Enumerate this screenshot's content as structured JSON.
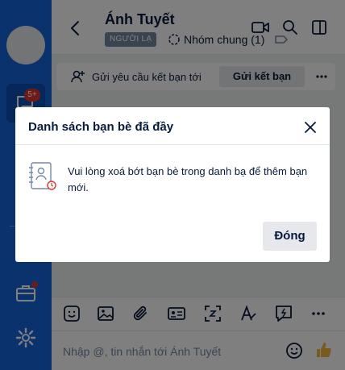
{
  "header": {
    "contact_name": "Ánh Tuyết",
    "stranger_tag": "NGƯỜI LẠ",
    "group_label": "Nhóm chung (1)"
  },
  "nav": {
    "unread_badge": "5+"
  },
  "friend_request_bar": {
    "text": "Gửi yêu cầu kết bạn tới",
    "button": "Gửi kết bạn"
  },
  "composer": {
    "placeholder": "Nhập @, tin nhắn tới Ánh Tuyết"
  },
  "modal": {
    "title": "Danh sách bạn bè đã đầy",
    "message": "Vui lòng xoá bớt bạn bè trong danh bạ để thêm bạn mới.",
    "close_button": "Đóng"
  },
  "colors": {
    "nav_blue": "#1565d8",
    "badge_red": "#e0352b",
    "text_dark": "#081b3a",
    "muted": "#7589a3"
  },
  "icons": [
    "back-arrow-icon",
    "video-call-icon",
    "search-icon",
    "sidebar-toggle-icon",
    "add-friend-icon",
    "more-icon",
    "sticker-icon",
    "image-icon",
    "attachment-icon",
    "contact-card-icon",
    "screenshot-icon",
    "format-text-icon",
    "quick-reply-icon",
    "emoji-icon",
    "thumbs-up-icon",
    "contacts-book-icon",
    "close-icon",
    "message-icon",
    "briefcase-icon",
    "settings-icon"
  ]
}
